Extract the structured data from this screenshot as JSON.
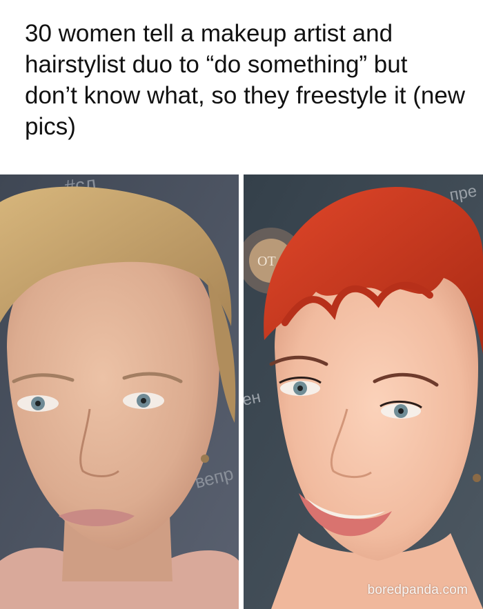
{
  "post": {
    "headline": "30 women tell a makeup artist and hairstylist duo to “do something” but don’t know what, so they freestyle it (new pics)"
  },
  "photos": {
    "watermark": "boredpanda.com",
    "left": {
      "wall_text_top": "#cл",
      "wall_text_mid": "вепр"
    },
    "right": {
      "wall_text_top": "пре",
      "wall_text_logo": "OT",
      "wall_text_mid": "ен"
    }
  },
  "colors": {
    "wall_left": "#4b5360",
    "wall_right": "#3e4850",
    "hair_left": "#c9a76e",
    "hair_right": "#c8391d",
    "skin_left": "#e2b49a",
    "skin_right": "#f3c1a6",
    "lips_right": "#d9736f"
  }
}
